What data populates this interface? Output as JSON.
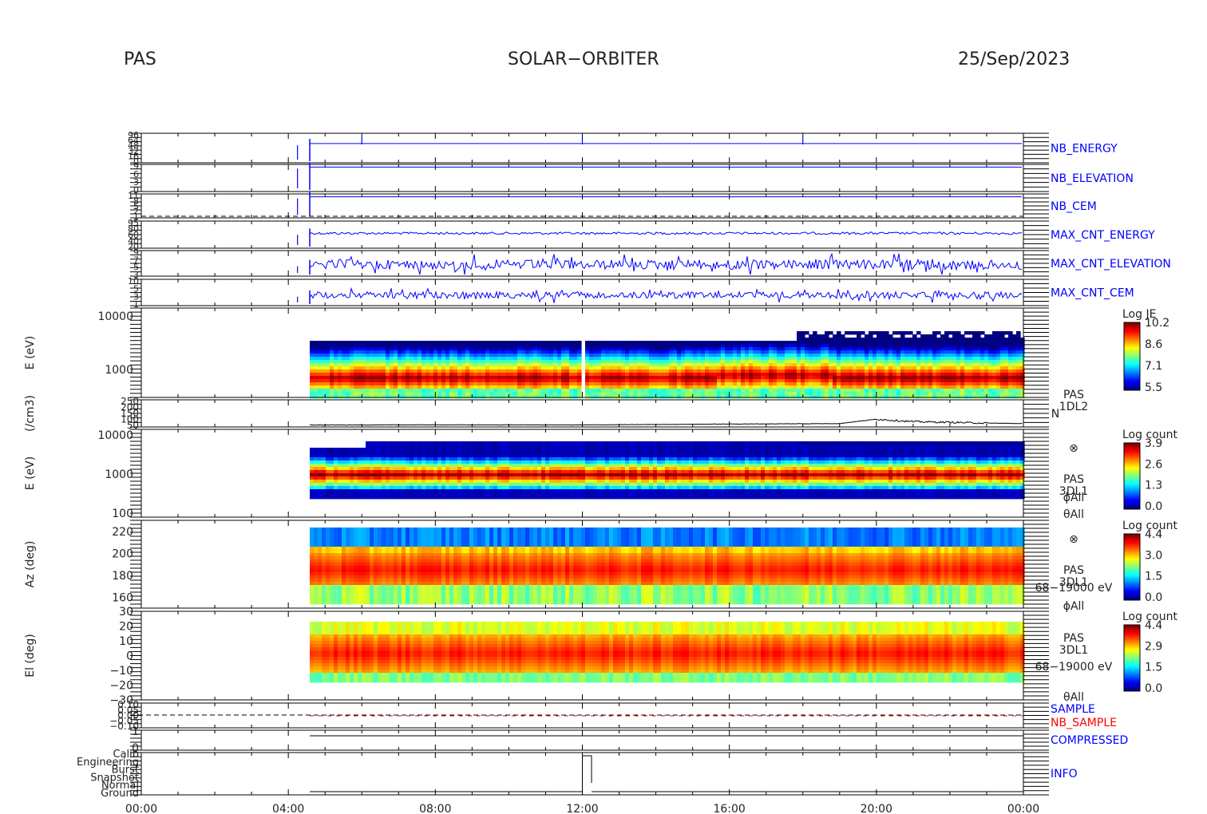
{
  "header": {
    "left": "PAS",
    "center": "SOLAR−ORBITER",
    "right": "25/Sep/2023"
  },
  "colors": {
    "hk_line": "#0000ff",
    "sample_red": "#ff0000",
    "trace": "#000000"
  },
  "chart_data": [
    {
      "type": "line",
      "title": "",
      "x_ticks": [
        "00:00",
        "04:00",
        "08:00",
        "12:00",
        "16:00",
        "20:00",
        "00:00"
      ],
      "panels": [
        {
          "id": "nb_energy",
          "label": "NB_ENERGY",
          "y_ticks": [
            "96",
            "64",
            "48",
            "32",
            "16",
            "0"
          ],
          "data_start": "04:35",
          "step_times": [
            "06:00",
            "12:00",
            "18:00"
          ]
        },
        {
          "id": "nb_elevation",
          "label": "NB_ELEVATION",
          "y_ticks": [
            "9",
            "6",
            "3",
            "0"
          ],
          "data_start": "04:35"
        },
        {
          "id": "nb_cem",
          "label": "NB_CEM",
          "y_ticks": [
            "11",
            "8",
            "5",
            "2",
            "1"
          ],
          "data_start": "04:35"
        },
        {
          "id": "max_cnt_energy",
          "label": "MAX_CNT_ENERGY",
          "y_ticks": [
            "95",
            "80",
            "60",
            "40",
            "20"
          ],
          "data_start": "04:35"
        },
        {
          "id": "max_cnt_elevation",
          "label": "MAX_CNT_ELEVATION",
          "y_ticks": [
            "9",
            "7",
            "5",
            "3"
          ],
          "data_start": "04:35"
        },
        {
          "id": "max_cnt_cem",
          "label": "MAX_CNT_CEM",
          "y_ticks": [
            "10",
            "5",
            "3",
            "1"
          ],
          "data_start": "04:35"
        }
      ]
    },
    {
      "type": "heatmap",
      "ylabel": "E (eV)",
      "y_scale": "log",
      "ylim": [
        300,
        14000
      ],
      "y_ticks": [
        1000,
        10000
      ],
      "colorbar": {
        "title": "Log JE",
        "ticks": [
          "10.2",
          "8.6",
          "7.1",
          "5.5"
        ]
      },
      "data_start": "04:35",
      "gap": "12:05"
    },
    {
      "type": "line",
      "ylabel": "(/cm3)",
      "side_labels": [
        "PAS",
        "1DL2",
        "N"
      ],
      "y_ticks": [
        "250",
        "200",
        "150",
        "100",
        "50"
      ],
      "ylim": [
        0,
        280
      ],
      "x": [
        "04:35",
        "08:00",
        "12:00",
        "16:00",
        "19:00",
        "20:00",
        "21:00",
        "23:00",
        "24:00"
      ],
      "values": [
        20,
        22,
        21,
        30,
        35,
        80,
        55,
        40,
        35
      ]
    },
    {
      "type": "heatmap",
      "ylabel": "E (eV)",
      "y_scale": "log",
      "ylim": [
        80,
        14000
      ],
      "y_ticks": [
        100,
        1000,
        10000
      ],
      "side_labels": [
        "⊗",
        "PAS",
        "3DL1",
        "ϕAll",
        "θAll"
      ],
      "colorbar": {
        "title": "Log count",
        "ticks": [
          "3.9",
          "2.6",
          "1.3",
          "0.0"
        ]
      },
      "data_start": "04:35"
    },
    {
      "type": "heatmap",
      "ylabel": "Az (deg)",
      "ylim": [
        150,
        230
      ],
      "y_ticks": [
        160,
        180,
        200,
        220
      ],
      "side_labels": [
        "⊗",
        "PAS",
        "3DL1",
        "68−19000 eV",
        "ϕAll"
      ],
      "colorbar": {
        "title": "Log count",
        "ticks": [
          "4.4",
          "3.0",
          "1.5",
          "0.0"
        ]
      },
      "data_start": "04:35"
    },
    {
      "type": "heatmap",
      "ylabel": "El (deg)",
      "ylim": [
        -30,
        30
      ],
      "y_ticks": [
        30,
        20,
        10,
        0,
        -10,
        -20,
        -30
      ],
      "y_tick_labels": [
        "30",
        "20",
        "10",
        "0",
        "−10",
        "−20",
        "−30"
      ],
      "side_labels": [
        "PAS",
        "3DL1",
        "68−19000 eV",
        "θAll"
      ],
      "colorbar": {
        "title": "Log count",
        "ticks": [
          "4.4",
          "2.9",
          "1.5",
          "0.0"
        ]
      },
      "data_start": "04:35"
    },
    {
      "type": "line",
      "labels": [
        "SAMPLE",
        "NB_SAMPLE"
      ],
      "y_ticks": [
        "0.10",
        "0.05",
        "0.00",
        "−0.05",
        "−0.10"
      ]
    },
    {
      "type": "line",
      "label": "COMPRESSED",
      "y_ticks": [
        "1",
        "0"
      ]
    },
    {
      "type": "line",
      "label": "INFO",
      "y_ticks": [
        "Calib",
        "Engineering",
        "Burst",
        "Snapshot",
        "Normal",
        "Ground"
      ],
      "events": [
        {
          "time": "12:00",
          "level": "Calib"
        }
      ]
    }
  ]
}
